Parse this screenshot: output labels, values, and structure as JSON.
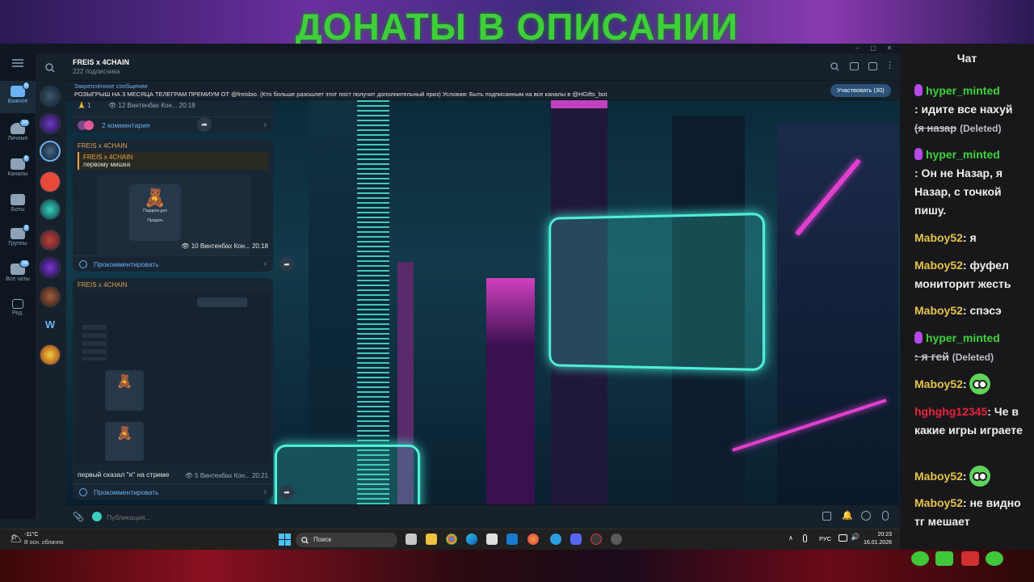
{
  "stream": {
    "banner": "ДОНАТЫ В ОПИСАНИИ"
  },
  "telegram": {
    "folders": [
      {
        "label": "Важное",
        "count": "6"
      },
      {
        "label": "Личные",
        "count": "34"
      },
      {
        "label": "Каналы",
        "count": "6"
      },
      {
        "label": "Боты",
        "count": ""
      },
      {
        "label": "Группы",
        "count": "9"
      },
      {
        "label": "Все чаты",
        "count": "36"
      },
      {
        "label": "Ред.",
        "count": ""
      }
    ],
    "header": {
      "title": "FREIS x 4CHAIN",
      "subtitle": "222 подписчика"
    },
    "pinned": {
      "label": "Закреплённое сообщение",
      "text": "РОЗЫГРЫШ НА 3 МЕСЯЦА ТЕЛЕГРАМ ПРЕМИУМ ОТ @freisbio. (Кто больше разошлет этот пост получит дополнительный приз) Условия: Быть подписанным на все каналы в @HGifts_bot",
      "button": "Участвовать (30)"
    },
    "posts": [
      {
        "meta_views": "12",
        "meta_sig": "Винтенбах Кон... 20:18",
        "reaction_count": "1",
        "comments": "2 комментария"
      },
      {
        "author": "FREIS x 4CHAIN",
        "quote_name": "FREIS x 4CHAIN",
        "quote_text": "первому мишка",
        "gift_caption": "Подарок для",
        "gift_note": "Продать",
        "meta_views": "10",
        "meta_sig": "Винтенбах Кон... 20:18",
        "comments": "Прокомментировать"
      },
      {
        "author": "FREIS x 4CHAIN",
        "caption": "первый сказал \"я\" на стриме",
        "meta_views": "5",
        "meta_sig": "Винтенбах Кон... 20:21",
        "comments": "Прокомментировать"
      }
    ],
    "composer_placeholder": "Публикация..."
  },
  "taskbar": {
    "weather_temp": "-11°C",
    "weather_desc": "В осн. облачно",
    "search": "Поиск",
    "lang": "РУС",
    "time": "20:23",
    "date": "16.01.2026"
  },
  "chat": {
    "title": "Чат",
    "messages": [
      {
        "user": "hyper_minted",
        "text": ": идите все нахуй",
        "deleted_text": "(я назар",
        "deleted_tag": "(Deleted)"
      },
      {
        "user": "hyper_minted",
        "text": ": Он не Назар, я Назар, с точкой пишу."
      },
      {
        "user": "Maboy52",
        "text": ": я"
      },
      {
        "user": "Maboy52",
        "text": ": фуфел мониторит жесть"
      },
      {
        "user": "Maboy52",
        "text": ": спэсэ"
      },
      {
        "user": "hyper_minted",
        "deleted_text": ": я гей",
        "deleted_tag": "(Deleted)"
      },
      {
        "user": "Maboy52",
        "text": ":"
      },
      {
        "user": "hghghg12345",
        "text": ": Че в какие игры играете"
      },
      {
        "user": "Maboy52",
        "text": ":"
      },
      {
        "user": "Maboy52",
        "text": ": не видно тг мешает"
      }
    ]
  }
}
